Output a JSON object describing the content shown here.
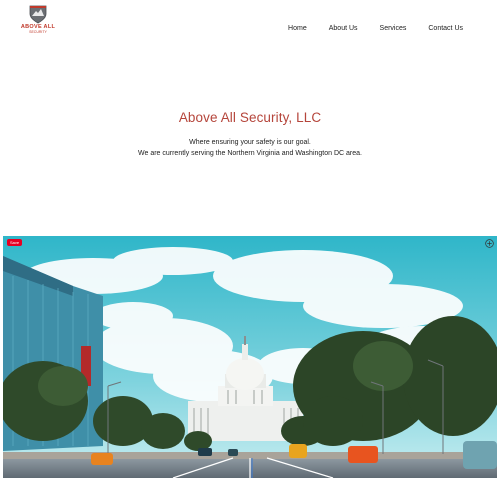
{
  "brand": {
    "name": "ABOVE ALL",
    "sub": "SECURITY"
  },
  "nav": {
    "items": [
      "Home",
      "About Us",
      "Services",
      "Contact Us"
    ]
  },
  "hero": {
    "title": "Above All Security, LLC",
    "line1": "Where ensuring your safety is our goal.",
    "line2": "We are currently serving the Northern Virginia and Washington DC area."
  },
  "photo": {
    "save_label": "Save",
    "subject": "capitol-building-photo"
  },
  "colors": {
    "accent": "#b5453b",
    "pinterest": "#e60023"
  }
}
